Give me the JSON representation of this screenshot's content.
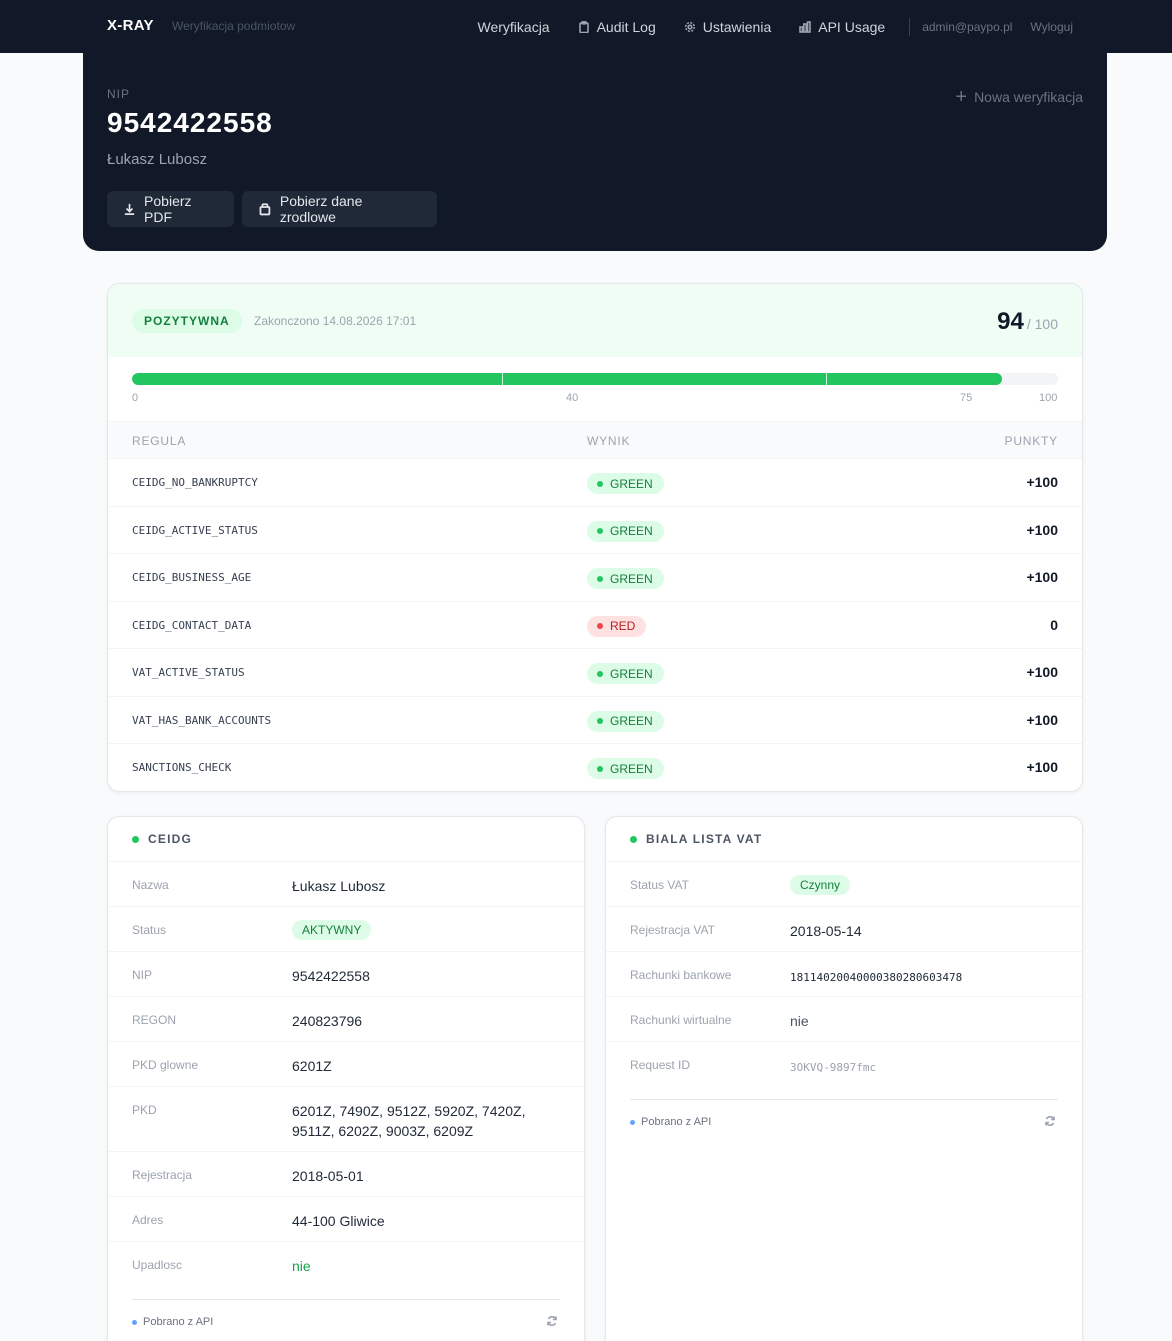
{
  "nav": {
    "brand": "X-RAY",
    "subtitle": "Weryfikacja podmiotow",
    "links": [
      {
        "label": "Weryfikacja",
        "icon": "none"
      },
      {
        "label": "Audit Log",
        "icon": "clipboard-icon"
      },
      {
        "label": "Ustawienia",
        "icon": "gear-icon"
      },
      {
        "label": "API Usage",
        "icon": "bar-chart-icon"
      }
    ],
    "email": "admin@paypo.pl",
    "logout": "Wyloguj"
  },
  "hero": {
    "label": "NIP",
    "nip": "9542422558",
    "name": "Łukasz Lubosz",
    "new_verification": "Nowa weryfikacja",
    "btn_pdf": "Pobierz PDF",
    "btn_source": "Pobierz dane zrodlowe"
  },
  "score": {
    "verdict": "POZYTYWNA",
    "finished": "Zakonczono 14.08.2026 17:01",
    "value": "94",
    "max": "/ 100",
    "progress_value": 94,
    "scale_labels": [
      "0",
      "40",
      "75",
      "100"
    ],
    "colors": {
      "positive": "#22c55e",
      "negative": "#ef4444"
    }
  },
  "rules_table": {
    "headers": {
      "rule": "REGULA",
      "result": "WYNIK",
      "points": "PUNKTY"
    },
    "rows": [
      {
        "rule": "CEIDG_NO_BANKRUPTCY",
        "result": "GREEN",
        "points": "+100"
      },
      {
        "rule": "CEIDG_ACTIVE_STATUS",
        "result": "GREEN",
        "points": "+100"
      },
      {
        "rule": "CEIDG_BUSINESS_AGE",
        "result": "GREEN",
        "points": "+100"
      },
      {
        "rule": "CEIDG_CONTACT_DATA",
        "result": "RED",
        "points": "0"
      },
      {
        "rule": "VAT_ACTIVE_STATUS",
        "result": "GREEN",
        "points": "+100"
      },
      {
        "rule": "VAT_HAS_BANK_ACCOUNTS",
        "result": "GREEN",
        "points": "+100"
      },
      {
        "rule": "SANCTIONS_CHECK",
        "result": "GREEN",
        "points": "+100"
      }
    ]
  },
  "ceidg": {
    "title": "CEIDG",
    "fields": {
      "name_label": "Nazwa",
      "name": "Łukasz Lubosz",
      "status_label": "Status",
      "status": "AKTYWNY",
      "nip_label": "NIP",
      "nip": "9542422558",
      "regon_label": "REGON",
      "regon": "240823796",
      "pkd_main_label": "PKD glowne",
      "pkd_main": "6201Z",
      "pkd_label": "PKD",
      "pkd": "6201Z, 7490Z, 9512Z, 5920Z, 7420Z, 9511Z, 6202Z, 9003Z, 6209Z",
      "registration_label": "Rejestracja",
      "registration": "2018-05-01",
      "address_label": "Adres",
      "address": "44-100 Gliwice",
      "bankruptcy_label": "Upadlosc",
      "bankruptcy": "nie"
    },
    "source": "Pobrano z API"
  },
  "vat": {
    "title": "BIALA LISTA VAT",
    "fields": {
      "status_label": "Status VAT",
      "status": "Czynny",
      "registration_label": "Rejestracja VAT",
      "registration": "2018-05-14",
      "accounts_label": "Rachunki bankowe",
      "accounts": "18114020040000380280603478",
      "virtual_label": "Rachunki wirtualne",
      "virtual": "nie",
      "request_label": "Request ID",
      "request": "3OKVQ-9897fmc"
    },
    "source": "Pobrano z API"
  }
}
